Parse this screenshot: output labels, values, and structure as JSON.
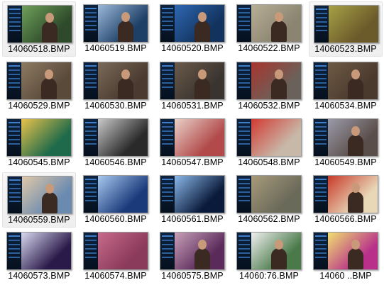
{
  "files": [
    {
      "name": "14060518.BMP",
      "bg": "#2e4a2a",
      "accent": "#6fa05a",
      "figure": true,
      "hover": true
    },
    {
      "name": "14060519.BMP",
      "bg": "#1e3f66",
      "accent": "#9ab8d8",
      "figure": true,
      "hover": false
    },
    {
      "name": "14060520.BMP",
      "bg": "#12335e",
      "accent": "#2f67b2",
      "figure": true,
      "hover": false
    },
    {
      "name": "14060522.BMP",
      "bg": "#8a8470",
      "accent": "#b8ae96",
      "figure": true,
      "hover": false
    },
    {
      "name": "14060523.BMP",
      "bg": "#6b5a2a",
      "accent": "#a7a046",
      "figure": false,
      "hover": true
    },
    {
      "name": "14060529.BMP",
      "bg": "#5a4a3a",
      "accent": "#8c7a62",
      "figure": true,
      "hover": false
    },
    {
      "name": "14060530.BMP",
      "bg": "#4a3a30",
      "accent": "#7a6a58",
      "figure": true,
      "hover": false
    },
    {
      "name": "14060531.BMP",
      "bg": "#3a3430",
      "accent": "#6a5a4a",
      "figure": true,
      "hover": false
    },
    {
      "name": "14060532.BMP",
      "bg": "#6a625a",
      "accent": "#a8342e",
      "figure": true,
      "hover": false
    },
    {
      "name": "14060534.BMP",
      "bg": "#4a3a2e",
      "accent": "#6e5a44",
      "figure": true,
      "hover": false
    },
    {
      "name": "14060545.BMP",
      "bg": "#1e6a4a",
      "accent": "#e8c24a",
      "figure": false,
      "hover": false
    },
    {
      "name": "14060546.BMP",
      "bg": "#2a2a2a",
      "accent": "#c8c8c8",
      "figure": false,
      "hover": false
    },
    {
      "name": "14060547.BMP",
      "bg": "#b24a4a",
      "accent": "#e8d0c8",
      "figure": false,
      "hover": false
    },
    {
      "name": "14060548.BMP",
      "bg": "#c8b8a8",
      "accent": "#d23a32",
      "figure": false,
      "hover": false
    },
    {
      "name": "14060549.BMP",
      "bg": "#5a4e4a",
      "accent": "#9a9aa8",
      "figure": true,
      "hover": false
    },
    {
      "name": "14060559.BMP",
      "bg": "#6a8ab0",
      "accent": "#e0c8a8",
      "figure": true,
      "hover": true
    },
    {
      "name": "14060560.BMP",
      "bg": "#1a3a7a",
      "accent": "#a8c8f0",
      "figure": false,
      "hover": false
    },
    {
      "name": "14060561.BMP",
      "bg": "#0a1a3a",
      "accent": "#8ab8e8",
      "figure": false,
      "hover": false
    },
    {
      "name": "14060562.BMP",
      "bg": "#6a6a5a",
      "accent": "#a89a7a",
      "figure": false,
      "hover": false
    },
    {
      "name": "14060566.BMP",
      "bg": "#e8d8b8",
      "accent": "#c83a2a",
      "figure": true,
      "hover": false
    },
    {
      "name": "14060573.BMP",
      "bg": "#2a1a4a",
      "accent": "#d8d8f0",
      "figure": false,
      "hover": false
    },
    {
      "name": "14060574.BMP",
      "bg": "#8a3a5a",
      "accent": "#c86a8a",
      "figure": false,
      "hover": false
    },
    {
      "name": "14060575.BMP",
      "bg": "#5a2a5a",
      "accent": "#c8a0b8",
      "figure": true,
      "hover": false
    },
    {
      "name": "14060:76.BMP",
      "bg": "#4a7a4a",
      "accent": "#f0f0f0",
      "figure": true,
      "hover": false
    },
    {
      "name": "14060 ..BMP",
      "bg": "#b8308a",
      "accent": "#f0e070",
      "figure": true,
      "hover": false
    }
  ]
}
